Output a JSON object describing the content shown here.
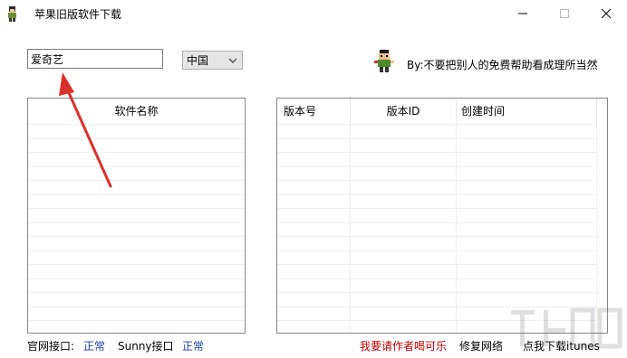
{
  "window": {
    "title": "苹果旧版软件下载",
    "controls": {
      "minimize": "—",
      "maximize": "☐",
      "close": "✕"
    }
  },
  "search": {
    "value": "爱奇艺"
  },
  "region": {
    "selected": "中国"
  },
  "credit": "By:不要把别人的免费帮助看成理所当然",
  "left_table": {
    "columns": [
      "软件名称"
    ],
    "rows": []
  },
  "right_table": {
    "columns": [
      "版本号",
      "版本ID",
      "创建时间"
    ],
    "rows": []
  },
  "status": {
    "official_label": "官网接口:",
    "official_state": "正常",
    "sunny_label": "Sunny接口",
    "sunny_state": "正常",
    "donate": "我要请作者喝可乐",
    "repair": "修复网络",
    "download": "点我下载itunes"
  },
  "icons": [
    "app-icon",
    "chevron-down-icon",
    "mascot-icon",
    "arrow-annotation-icon"
  ]
}
